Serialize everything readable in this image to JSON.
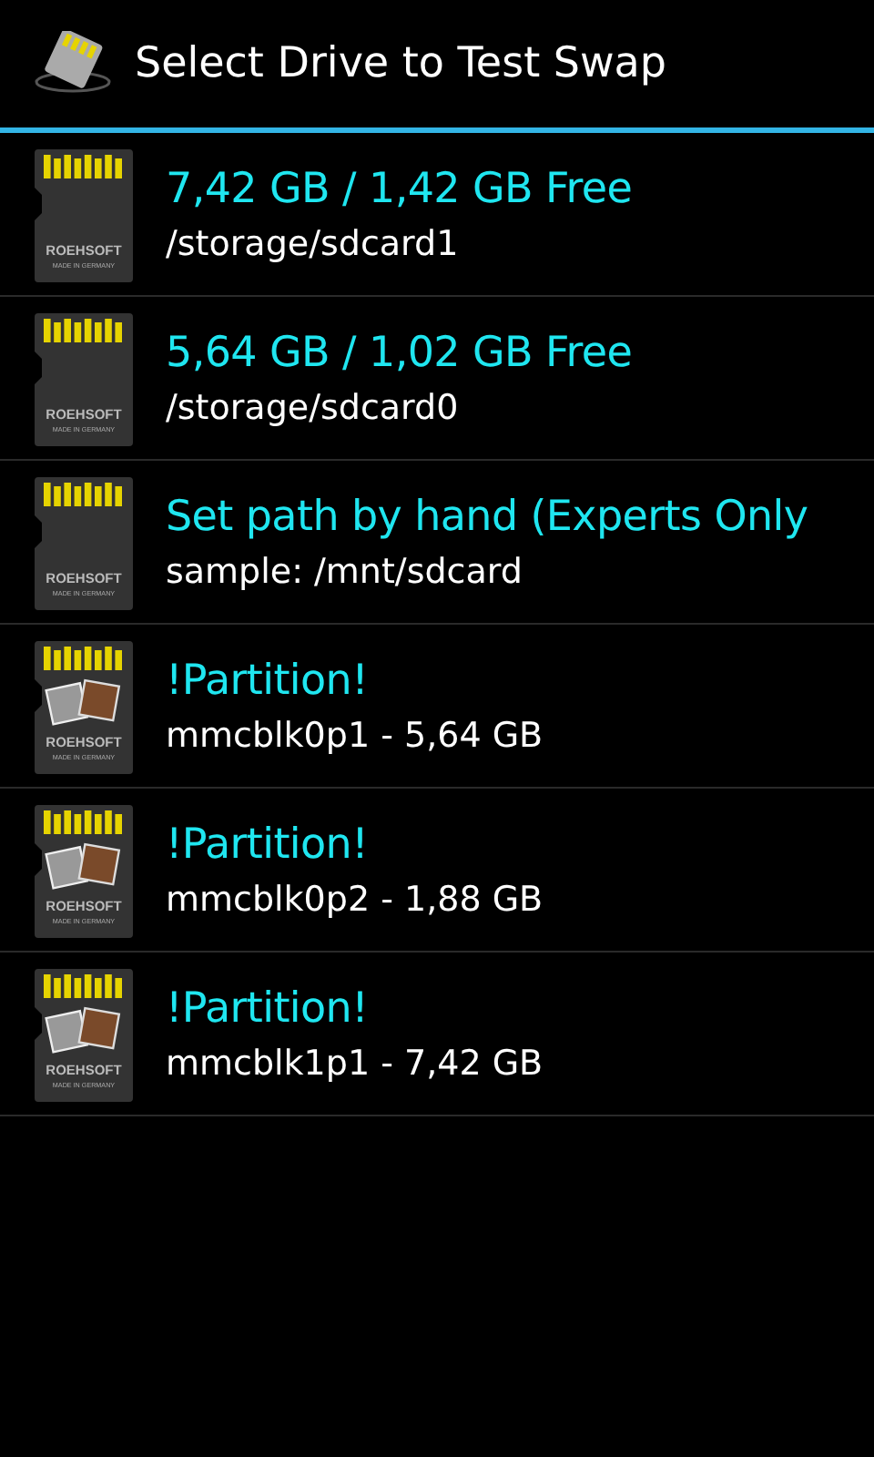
{
  "header": {
    "title": "Select Drive to Test Swap"
  },
  "drives": [
    {
      "kind": "card",
      "title": "7,42 GB / 1,42 GB Free",
      "subtitle": "/storage/sdcard1",
      "brand": "ROEHSOFT",
      "origin": "MADE IN GERMANY"
    },
    {
      "kind": "card",
      "title": "5,64 GB / 1,02 GB Free",
      "subtitle": "/storage/sdcard0",
      "brand": "ROEHSOFT",
      "origin": "MADE IN GERMANY"
    },
    {
      "kind": "card",
      "title": "Set path by hand (Experts Only",
      "subtitle": "sample: /mnt/sdcard",
      "brand": "ROEHSOFT",
      "origin": "MADE IN GERMANY"
    },
    {
      "kind": "partition",
      "title": "!Partition!",
      "subtitle": "mmcblk0p1 - 5,64 GB",
      "brand": "ROEHSOFT",
      "origin": "MADE IN GERMANY"
    },
    {
      "kind": "partition",
      "title": "!Partition!",
      "subtitle": "mmcblk0p2 - 1,88 GB",
      "brand": "ROEHSOFT",
      "origin": "MADE IN GERMANY"
    },
    {
      "kind": "partition",
      "title": "!Partition!",
      "subtitle": "mmcblk1p1 - 7,42 GB",
      "brand": "ROEHSOFT",
      "origin": "MADE IN GERMANY"
    }
  ]
}
